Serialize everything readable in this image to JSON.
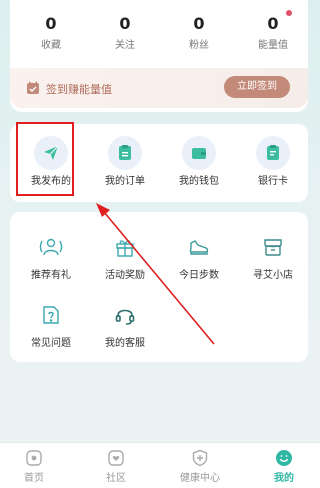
{
  "stats": [
    {
      "value": "0",
      "label": "收藏"
    },
    {
      "value": "0",
      "label": "关注"
    },
    {
      "value": "0",
      "label": "粉丝"
    },
    {
      "value": "0",
      "label": "能量值"
    }
  ],
  "signin": {
    "text": "签到赚能量值",
    "button": "立即签到"
  },
  "quick_links": [
    {
      "label": "我发布的",
      "icon": "send-icon"
    },
    {
      "label": "我的订单",
      "icon": "order-icon"
    },
    {
      "label": "我的钱包",
      "icon": "wallet-icon"
    },
    {
      "label": "银行卡",
      "icon": "bank-card-icon"
    }
  ],
  "services": [
    {
      "label": "推荐有礼",
      "icon": "recommend-icon"
    },
    {
      "label": "活动奖励",
      "icon": "gift-icon"
    },
    {
      "label": "今日步数",
      "icon": "shoe-icon"
    },
    {
      "label": "寻艾小店",
      "icon": "shop-icon"
    },
    {
      "label": "常见问题",
      "icon": "faq-icon"
    },
    {
      "label": "我的客服",
      "icon": "headset-icon"
    }
  ],
  "tabs": [
    {
      "label": "首页"
    },
    {
      "label": "社区"
    },
    {
      "label": "健康中心"
    },
    {
      "label": "我的"
    }
  ],
  "colors": {
    "accent": "#31b7a6",
    "highlight": "#e02020",
    "signin_button": "#c38a7a"
  }
}
